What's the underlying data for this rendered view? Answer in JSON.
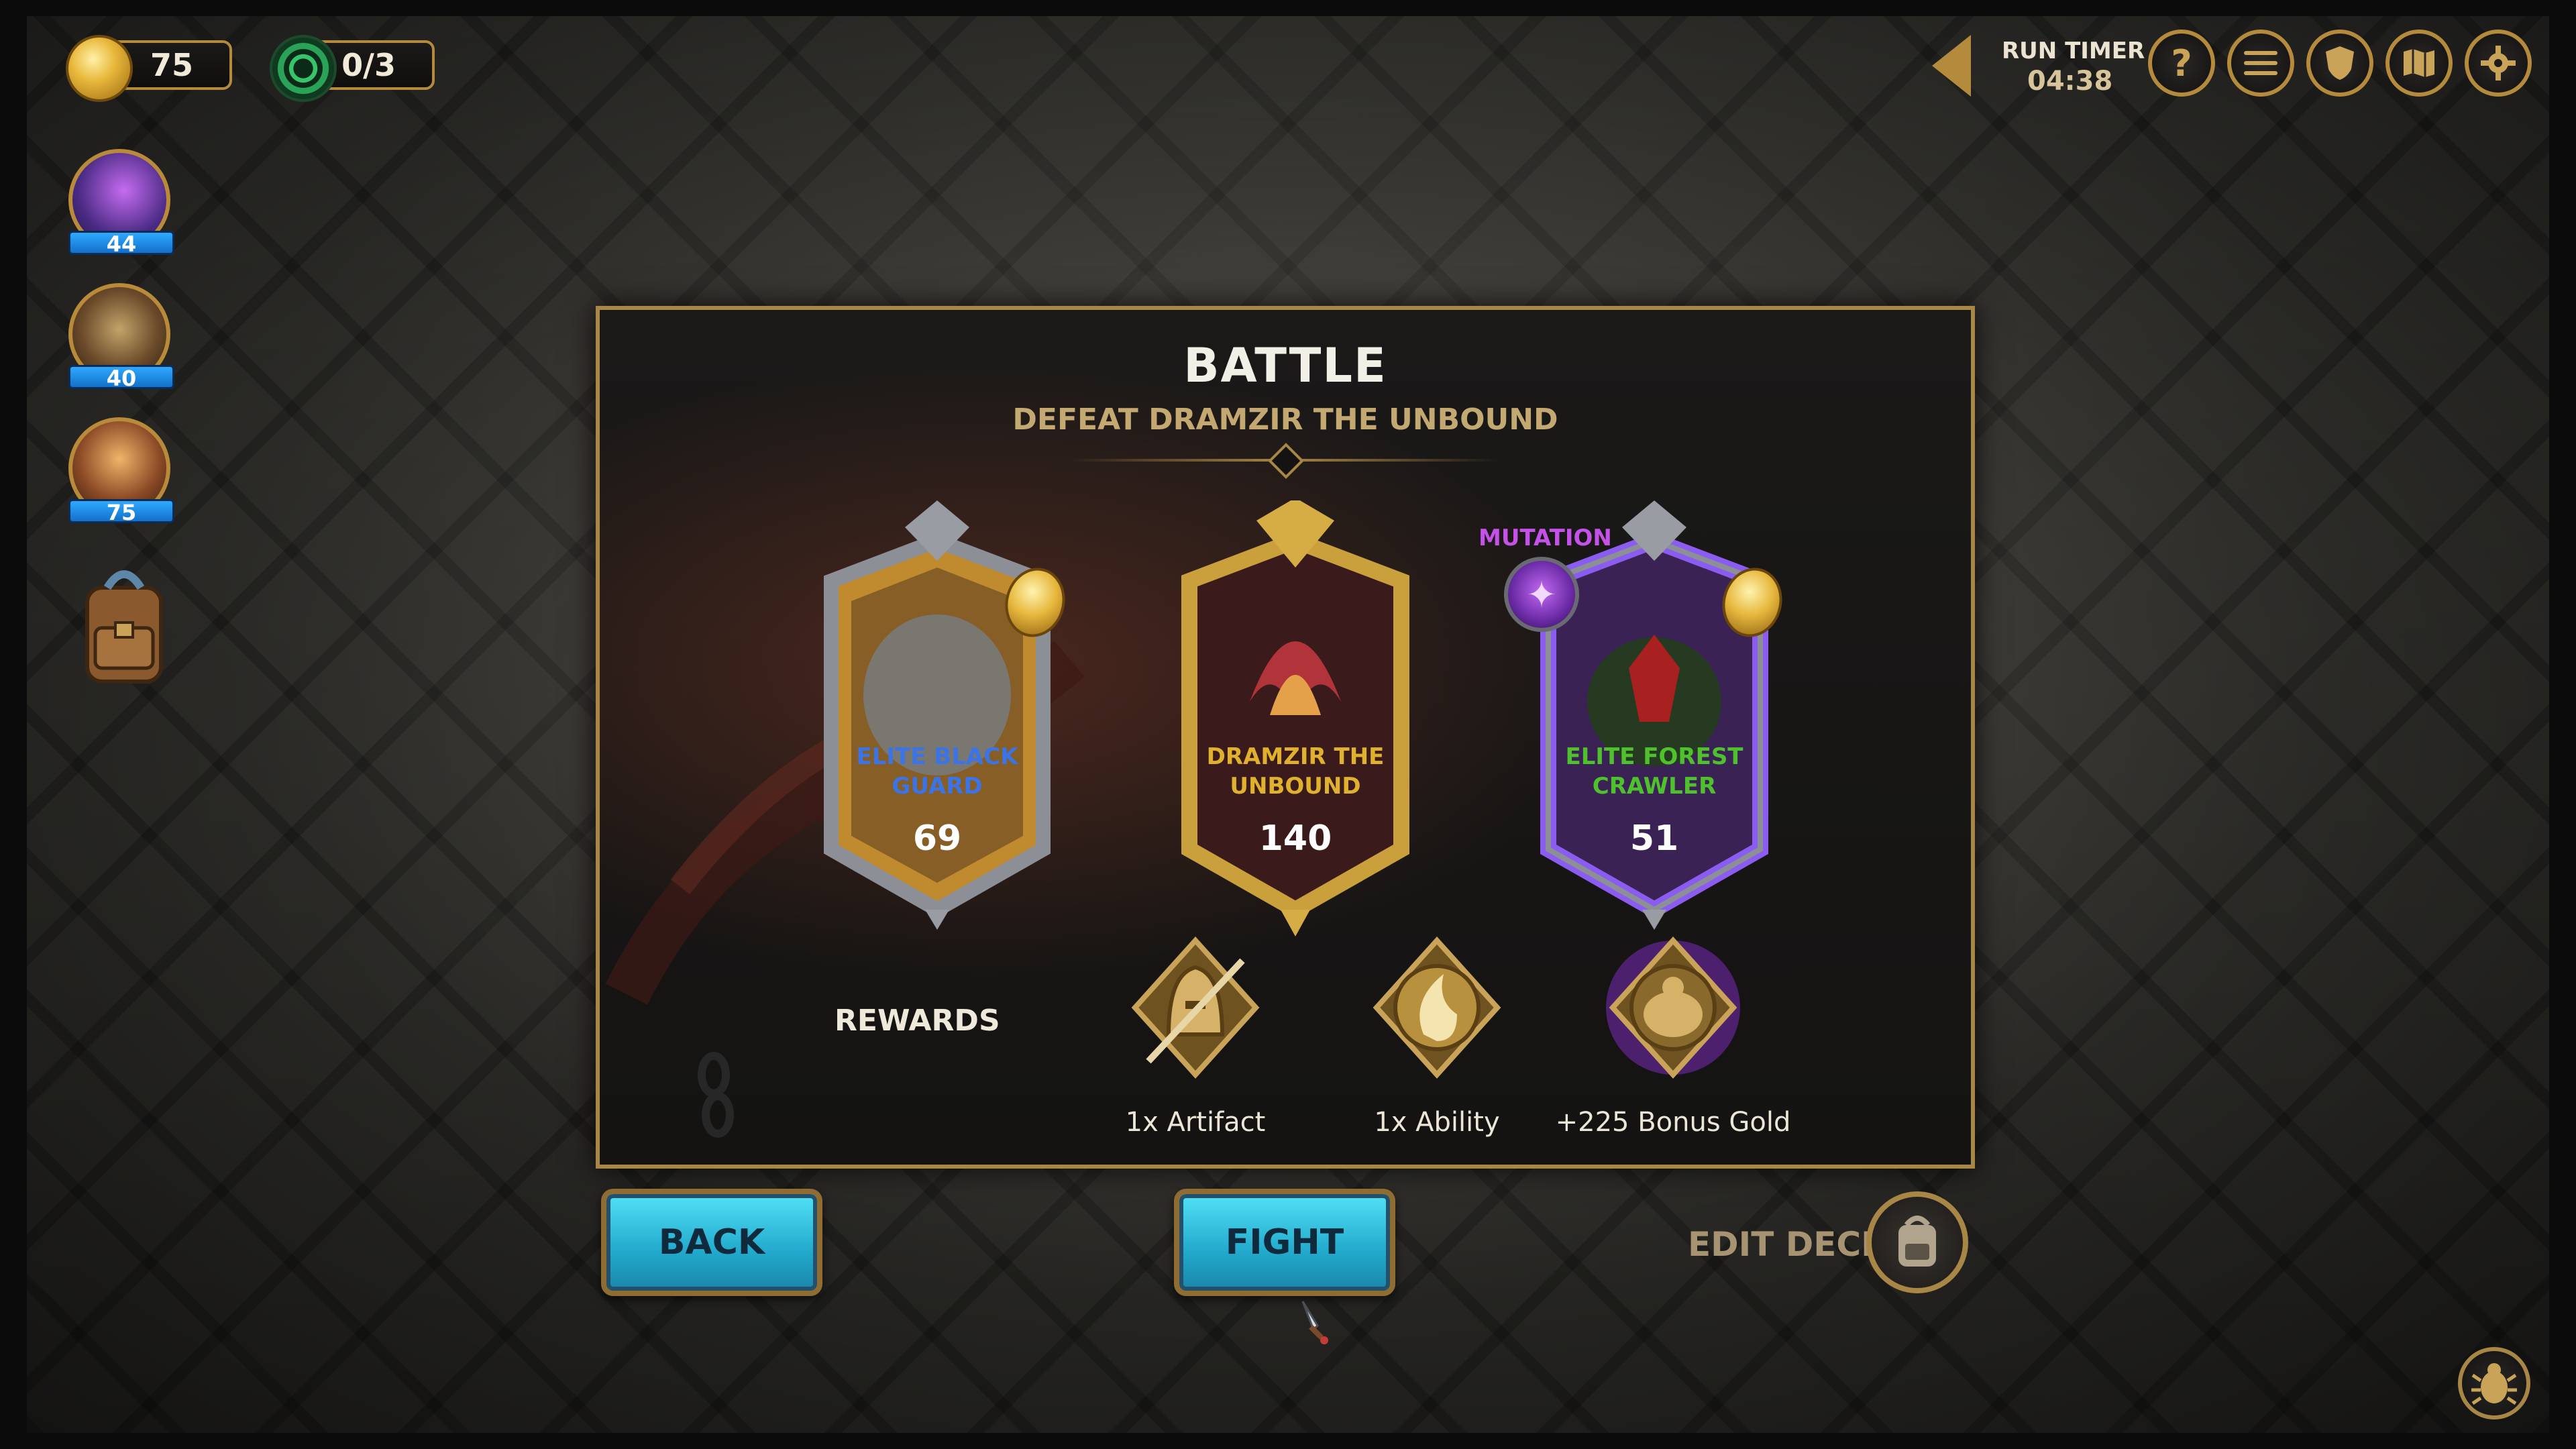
{
  "resources": {
    "gold": "75",
    "portals": "0/3"
  },
  "party": [
    {
      "hp": "44"
    },
    {
      "hp": "40"
    },
    {
      "hp": "75"
    }
  ],
  "hud": {
    "run_timer_label": "RUN TIMER",
    "run_timer_value": "04:38",
    "icons": [
      "help-icon",
      "menu-icon",
      "shield-icon",
      "map-icon",
      "settings-icon"
    ]
  },
  "battle": {
    "title": "BATTLE",
    "subtitle": "DEFEAT DRAMZIR THE UNBOUND",
    "mutation_label": "MUTATION",
    "enemies": [
      {
        "name": "ELITE BLACK GUARD",
        "hp": "69",
        "rarity_color": "#3b74e6"
      },
      {
        "name": "DRAMZIR THE UNBOUND",
        "hp": "140",
        "rarity_color": "#e0b12e"
      },
      {
        "name": "ELITE FOREST CRAWLER",
        "hp": "51",
        "rarity_color": "#4ec12d"
      }
    ],
    "rewards_label": "REWARDS",
    "rewards": [
      {
        "label": "1x Artifact",
        "icon": "helmet-sword-icon"
      },
      {
        "label": "1x Ability",
        "icon": "flame-orb-icon"
      },
      {
        "label": "+225 Bonus Gold",
        "icon": "gold-sack-icon"
      }
    ]
  },
  "actions": {
    "back": "BACK",
    "fight": "FIGHT",
    "edit_deck": "EDIT DECK"
  },
  "colors": {
    "frame_gold": "#a78646",
    "button_cyan": "#22a9cc",
    "mutation_purple": "#c552e8"
  }
}
